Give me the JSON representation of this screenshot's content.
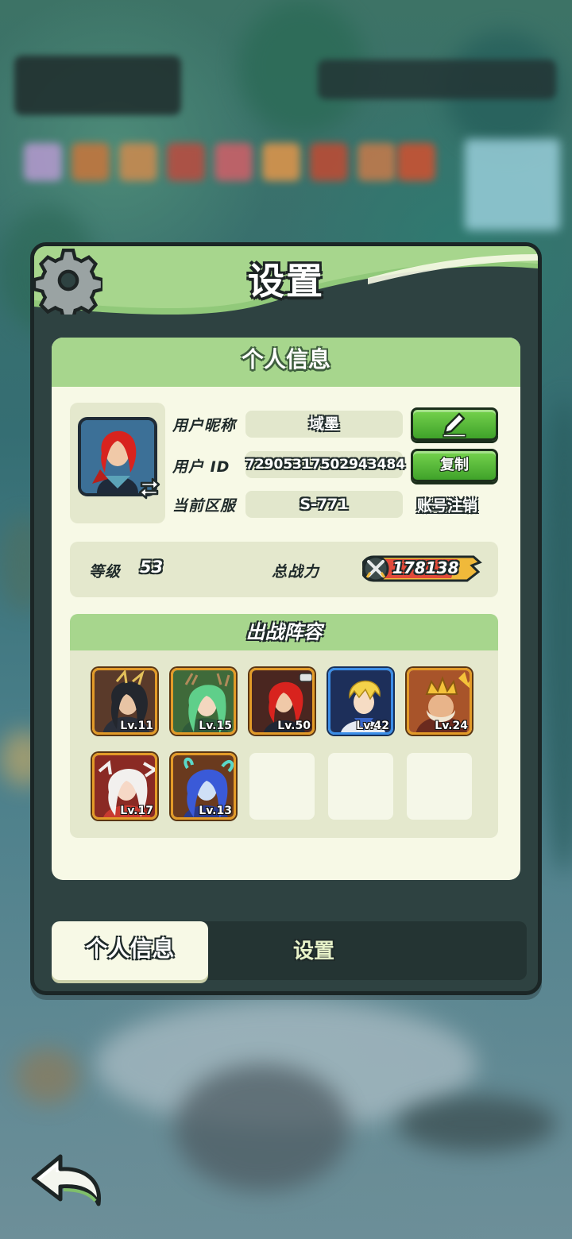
{
  "panel": {
    "title": "设置",
    "section_title": "个人信息"
  },
  "profile": {
    "nickname_label": "用户昵称",
    "nickname_value": "域墨",
    "uid_label": "用户 ID",
    "uid_value": "7290531750294348​4",
    "server_label": "当前区服",
    "server_value": "S-771",
    "copy_button": "复制",
    "cancel_account": "账号注销"
  },
  "stats": {
    "level_label": "等级",
    "level_value": "53",
    "power_label": "总战力",
    "power_value": "178138"
  },
  "team": {
    "title": "出战阵容",
    "heroes": [
      {
        "level": "Lv.11",
        "frame": "gold"
      },
      {
        "level": "Lv.15",
        "frame": "gold"
      },
      {
        "level": "Lv.50",
        "frame": "gold"
      },
      {
        "level": "Lv.42",
        "frame": "blue"
      },
      {
        "level": "Lv.24",
        "frame": "gold"
      },
      {
        "level": "Lv.17",
        "frame": "gold"
      },
      {
        "level": "Lv.13",
        "frame": "gold"
      }
    ],
    "empty_slots": 3
  },
  "tabs": {
    "active": "个人信息",
    "other": "设置"
  },
  "colors": {
    "accent_green": "#a7d68d",
    "button_green": "#4fb233",
    "card_bg": "#f7f9e6",
    "panel_dark": "#2e4241"
  },
  "icons": {
    "settings": "gear-icon",
    "edit": "pencil-icon",
    "swap": "swap-arrows-icon",
    "power": "crossed-swords-icon",
    "back": "back-arrow-icon"
  }
}
